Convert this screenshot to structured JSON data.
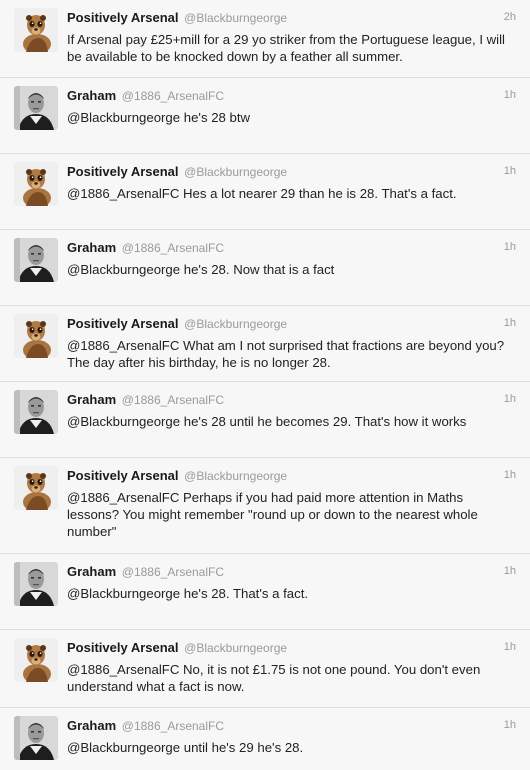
{
  "tweets": [
    {
      "name": "Positively Arsenal",
      "handle": "@Blackburngeorge",
      "time": "2h",
      "avatar": "meerkat-avatar-icon",
      "text": "If Arsenal pay £25+mill for a 29 yo striker from the  Portuguese league, I will be available to be knocked down by a feather all summer."
    },
    {
      "name": "Graham",
      "handle": "@1886_ArsenalFC",
      "time": "1h",
      "avatar": "footballer-avatar-icon",
      "text": "@Blackburngeorge he's 28 btw"
    },
    {
      "name": "Positively Arsenal",
      "handle": "@Blackburngeorge",
      "time": "1h",
      "avatar": "meerkat-avatar-icon",
      "text": "@1886_ArsenalFC Hes a lot nearer 29 than he is 28. That's a fact."
    },
    {
      "name": "Graham",
      "handle": "@1886_ArsenalFC",
      "time": "1h",
      "avatar": "footballer-avatar-icon",
      "text": "@Blackburngeorge he's 28. Now that is a fact"
    },
    {
      "name": "Positively Arsenal",
      "handle": "@Blackburngeorge",
      "time": "1h",
      "avatar": "meerkat-avatar-icon",
      "text": "@1886_ArsenalFC  What am I not surprised that fractions are beyond you? The day after his birthday, he is no longer 28."
    },
    {
      "name": "Graham",
      "handle": "@1886_ArsenalFC",
      "time": "1h",
      "avatar": "footballer-avatar-icon",
      "text": "@Blackburngeorge he's 28 until he becomes 29. That's how it works"
    },
    {
      "name": "Positively Arsenal",
      "handle": "@Blackburngeorge",
      "time": "1h",
      "avatar": "meerkat-avatar-icon",
      "text": "@1886_ArsenalFC Perhaps if you had paid more attention in Maths lessons? You might remember \"round up or down to the nearest whole number\""
    },
    {
      "name": "Graham",
      "handle": "@1886_ArsenalFC",
      "time": "1h",
      "avatar": "footballer-avatar-icon",
      "text": "@Blackburngeorge he's 28. That's a fact."
    },
    {
      "name": "Positively Arsenal",
      "handle": "@Blackburngeorge",
      "time": "1h",
      "avatar": "meerkat-avatar-icon",
      "text": "@1886_ArsenalFC No, it is not £1.75 is not one pound. You don't even understand what a fact is now."
    },
    {
      "name": "Graham",
      "handle": "@1886_ArsenalFC",
      "time": "1h",
      "avatar": "footballer-avatar-icon",
      "text": "@Blackburngeorge until he's 29 he's 28."
    }
  ]
}
